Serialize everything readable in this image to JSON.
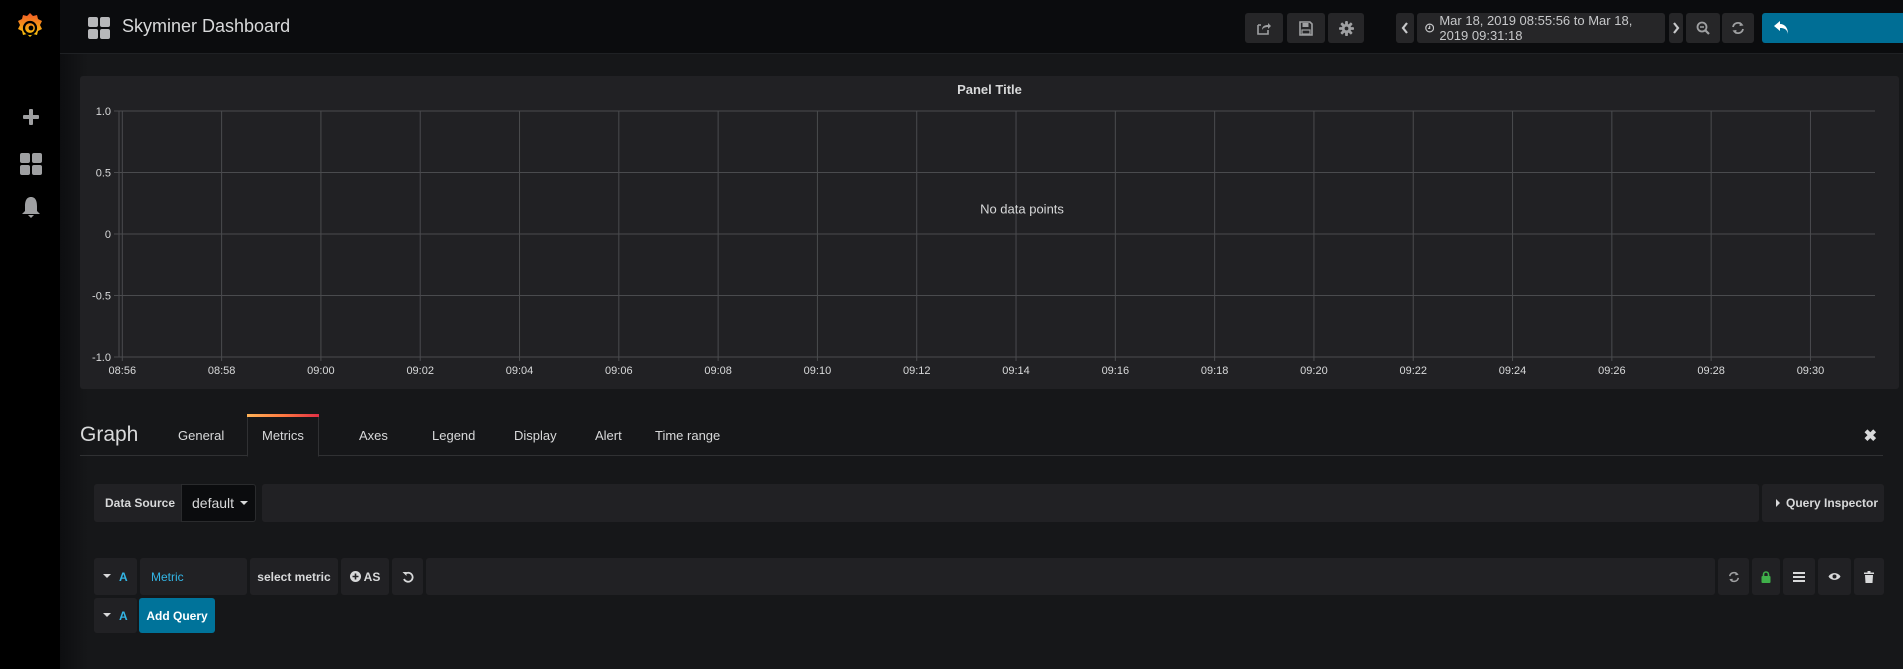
{
  "sidemenu": {
    "logo": "grafana-logo-icon",
    "items": [
      {
        "name": "create",
        "icon": "plus-icon"
      },
      {
        "name": "dashboards",
        "icon": "dashboards-icon"
      },
      {
        "name": "alerting",
        "icon": "bell-icon"
      }
    ]
  },
  "navbar": {
    "title": "Skyminer Dashboard",
    "buttons": [
      "share",
      "save",
      "settings"
    ],
    "time_range": "Mar 18, 2019 08:55:56 to Mar 18, 2019 09:31:18"
  },
  "panel": {
    "title": "Panel Title",
    "no_data": "No data points"
  },
  "chart_data": {
    "type": "line",
    "title": "Panel Title",
    "series": [],
    "empty_message": "No data points",
    "y_ticks": [
      "1.0",
      "0.5",
      "0",
      "-0.5",
      "-1.0"
    ],
    "y_values": [
      1.0,
      0.5,
      0,
      -0.5,
      -1.0
    ],
    "ylim": [
      -1.0,
      1.0
    ],
    "x_ticks": [
      "08:56",
      "08:58",
      "09:00",
      "09:02",
      "09:04",
      "09:06",
      "09:08",
      "09:10",
      "09:12",
      "09:14",
      "09:16",
      "09:18",
      "09:20",
      "09:22",
      "09:24",
      "09:26",
      "09:28",
      "09:30"
    ],
    "xlim": [
      "08:55:56",
      "09:31:18"
    ],
    "grid": true,
    "legend": "none"
  },
  "editor": {
    "title": "Graph",
    "tabs": [
      "General",
      "Metrics",
      "Axes",
      "Legend",
      "Display",
      "Alert",
      "Time range"
    ],
    "active_tab": "Metrics"
  },
  "datasource": {
    "label": "Data Source",
    "value": "default",
    "query_inspector": "Query Inspector"
  },
  "query": {
    "ref": "A",
    "metric_label": "Metric",
    "select_metric": "select metric",
    "as_label": "AS"
  },
  "add_query": {
    "ref": "A",
    "label": "Add Query"
  },
  "colors": {
    "accent": "#33b5e5",
    "primary": "#00739a",
    "lock": "#3fb04a"
  }
}
